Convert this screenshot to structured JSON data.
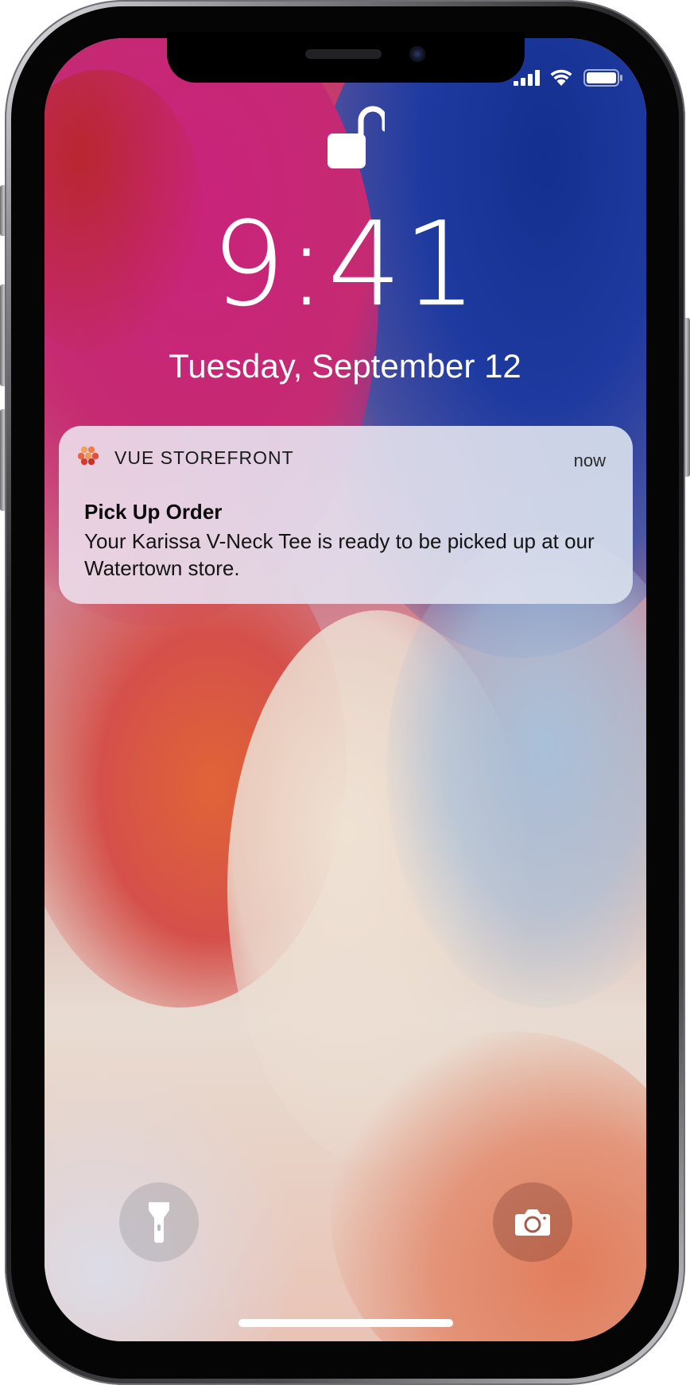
{
  "status_bar": {
    "icons": [
      "signal-icon",
      "wifi-icon",
      "battery-icon"
    ]
  },
  "lock_screen": {
    "lock_state_icon": "unlocked-padlock-icon",
    "time": "9:41",
    "date": "Tuesday, September 12"
  },
  "notification": {
    "app_icon": "vue-storefront-logo-icon",
    "app_name": "VUE STOREFRONT",
    "time": "now",
    "title": "Pick Up Order",
    "body": "Your Karissa V-Neck Tee is ready to be picked up at our Watertown store."
  },
  "quick_actions": {
    "left_icon": "flashlight-icon",
    "right_icon": "camera-icon"
  },
  "colors": {
    "wallpaper_blue": "#13308f",
    "wallpaper_pink": "#c9237b",
    "wallpaper_orange": "#e06437",
    "text": "#ffffff"
  }
}
